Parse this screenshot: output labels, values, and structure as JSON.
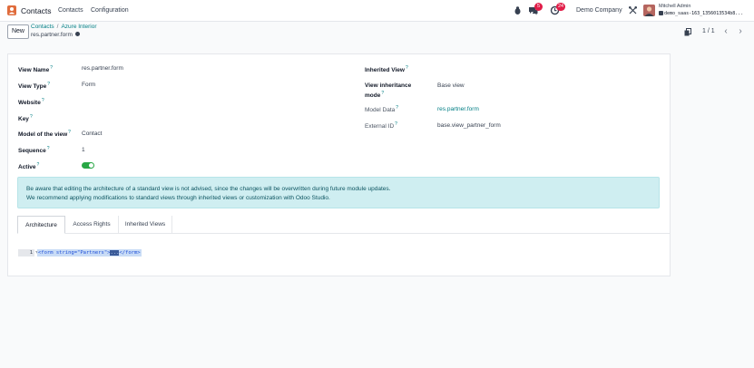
{
  "navbar": {
    "app_name": "Contacts",
    "menu": [
      "Contacts",
      "Configuration"
    ],
    "messages_badge": "5",
    "activities_badge": "24",
    "company": "Demo Company",
    "user_name": "Mitchell Admin",
    "database": "demo_saas-163_1356013534b8..."
  },
  "control": {
    "new_label": "New",
    "breadcrumb": [
      "Contacts",
      "Azure Interior"
    ],
    "record_title": "res.partner.form",
    "pager": "1 / 1"
  },
  "form": {
    "left": [
      {
        "label": "View Name",
        "value": "res.partner.form"
      },
      {
        "label": "View Type",
        "value": "Form"
      },
      {
        "label": "Website",
        "value": ""
      },
      {
        "label": "Key",
        "value": ""
      },
      {
        "label": "Model of the view",
        "value": "Contact"
      },
      {
        "label": "Sequence",
        "value": "1"
      },
      {
        "label": "Active",
        "value": true
      }
    ],
    "right": [
      {
        "label": "Inherited View",
        "value": ""
      },
      {
        "label_line1": "View inheritance",
        "label_line2": "mode",
        "value": "Base view"
      },
      {
        "label": "Model Data",
        "value": "res.partner.form"
      },
      {
        "label": "External ID",
        "value": "base.view_partner_form"
      }
    ],
    "help_mark": "?"
  },
  "alert": {
    "line1": "Be aware that editing the architecture of a standard view is not advised, since the changes will be overwritten during future module updates.",
    "line2": "We recommend applying modifications to standard views through inherited views or customization with Odoo Studio."
  },
  "tabs": [
    "Architecture",
    "Access Rights",
    "Inherited Views"
  ],
  "code": {
    "line_number": "1",
    "text_before": "<form string=\"Partners\">",
    "text_highlight": "...",
    "text_after": "</form>"
  },
  "colors": {
    "accent": "#017e84",
    "badge": "#e11d48",
    "toggle_on": "#28a745",
    "alert_bg": "#cfeef1"
  }
}
